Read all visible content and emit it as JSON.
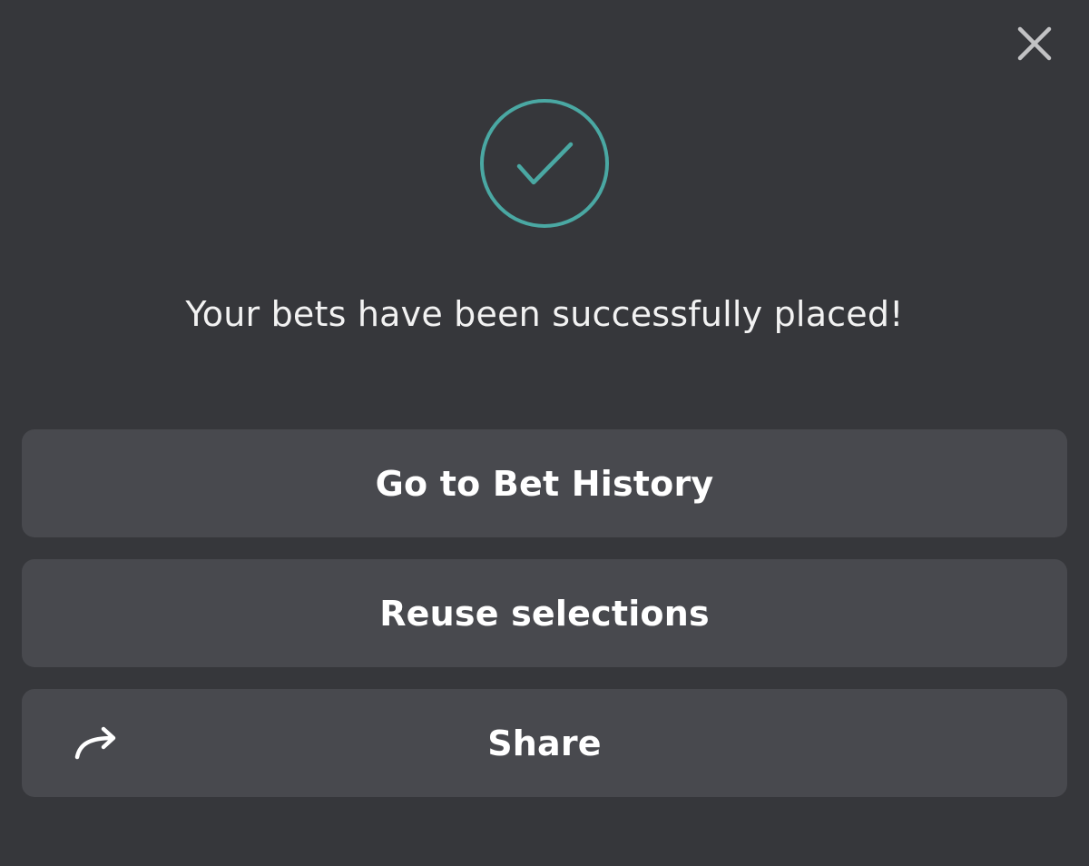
{
  "dialog": {
    "close_icon": "close-icon",
    "success_icon": "checkmark-circle-icon",
    "message": "Your bets have been successfully placed!",
    "accent_color": "#4aa8a3",
    "background_color": "#36373b",
    "button_color": "#48494e"
  },
  "actions": {
    "history_label": "Go to Bet History",
    "reuse_label": "Reuse selections",
    "share_label": "Share",
    "share_icon": "share-arrow-icon"
  }
}
